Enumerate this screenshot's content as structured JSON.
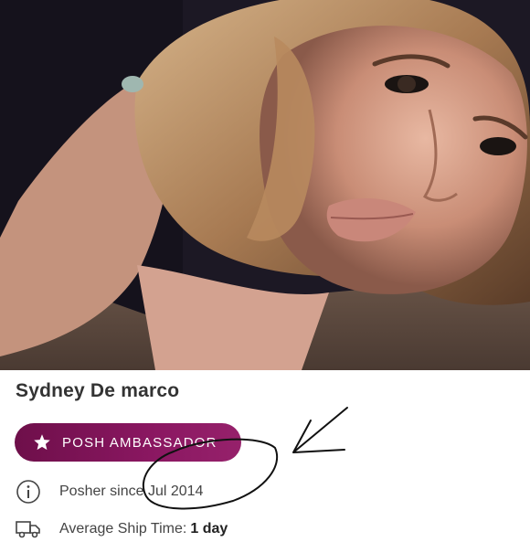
{
  "profile": {
    "name": "Sydney De marco",
    "badge_label": "POSH AMBASSADOR",
    "since_label": "Posher since Jul 2014",
    "ship_label": "Average Ship Time:",
    "ship_value": "1 day"
  },
  "icons": {
    "badge": "star-icon",
    "since": "info-icon",
    "ship": "truck-icon"
  },
  "colors": {
    "badge_start": "#6e0f4a",
    "badge_end": "#96216b",
    "name_text": "#333333",
    "annotation": "#111111"
  }
}
